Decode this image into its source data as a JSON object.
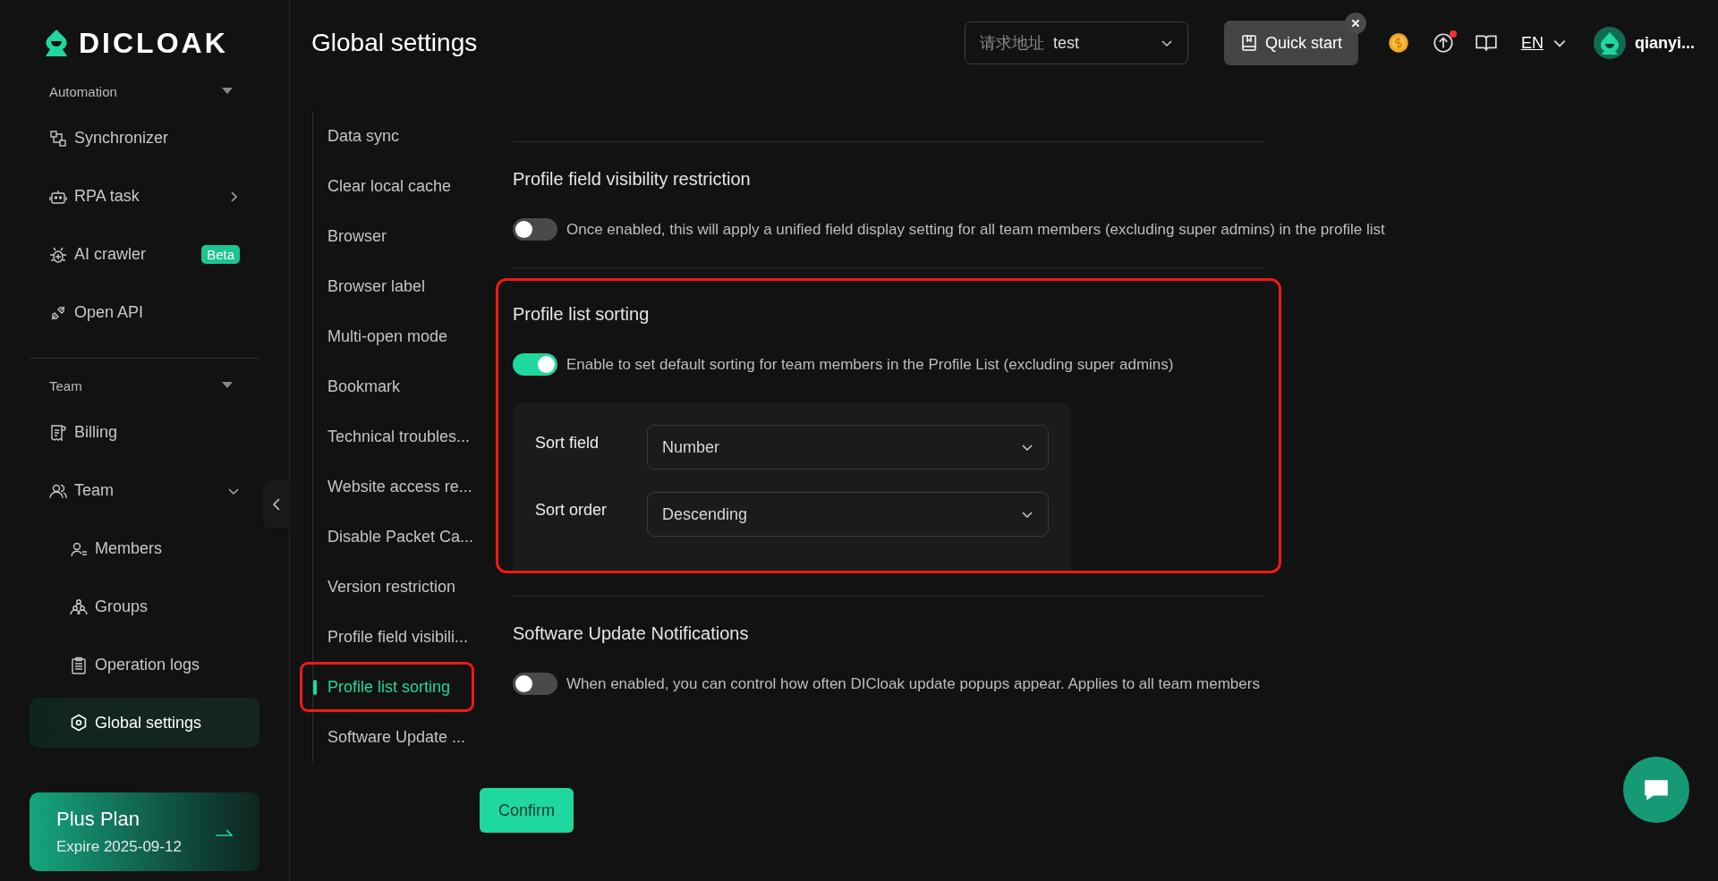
{
  "logo": {
    "text": "DICLOAK"
  },
  "sidebar": {
    "sections": [
      {
        "title": "Automation",
        "expanded": true,
        "items": [
          {
            "label": "Synchronizer",
            "kind": "link",
            "selected": false
          },
          {
            "label": "RPA task",
            "kind": "submenu",
            "selected": false
          },
          {
            "label": "AI crawler",
            "kind": "link",
            "badge": "Beta",
            "selected": false
          },
          {
            "label": "Open API",
            "kind": "link",
            "selected": false
          }
        ]
      },
      {
        "title": "Team",
        "expanded": true,
        "items": [
          {
            "label": "Billing",
            "kind": "link",
            "selected": false
          },
          {
            "label": "Team",
            "kind": "group",
            "expanded": true,
            "selected": false,
            "children": [
              {
                "label": "Members",
                "selected": false
              },
              {
                "label": "Groups",
                "selected": false
              },
              {
                "label": "Operation logs",
                "selected": false
              },
              {
                "label": "Global settings",
                "selected": true
              }
            ]
          }
        ]
      }
    ]
  },
  "plan": {
    "title": "Plus Plan",
    "expiry": "Expire 2025-09-12"
  },
  "header": {
    "title": "Global settings",
    "address": {
      "label": "请求地址",
      "value": "test"
    },
    "quick_start": "Quick start",
    "update_available": true,
    "language": "EN",
    "user": "qianyi..."
  },
  "settings_nav": [
    {
      "label": "Data sync",
      "selected": false,
      "highlighted": false
    },
    {
      "label": "Clear local cache",
      "selected": false,
      "highlighted": false
    },
    {
      "label": "Browser",
      "selected": false,
      "highlighted": false
    },
    {
      "label": "Browser label",
      "selected": false,
      "highlighted": false
    },
    {
      "label": "Multi-open mode",
      "selected": false,
      "highlighted": false
    },
    {
      "label": "Bookmark",
      "selected": false,
      "highlighted": false
    },
    {
      "label": "Technical troubles...",
      "selected": false,
      "highlighted": false
    },
    {
      "label": "Website access re...",
      "selected": false,
      "highlighted": false
    },
    {
      "label": "Disable Packet Ca...",
      "selected": false,
      "highlighted": false
    },
    {
      "label": "Version restriction",
      "selected": false,
      "highlighted": false
    },
    {
      "label": "Profile field visibili...",
      "selected": false,
      "highlighted": false
    },
    {
      "label": "Profile list sorting",
      "selected": true,
      "highlighted": true
    },
    {
      "label": "Software Update ...",
      "selected": false,
      "highlighted": false
    }
  ],
  "sections": [
    {
      "title": "Profile field visibility restriction",
      "on": false,
      "description": "Once enabled, this will apply a unified field display setting for all team members (excluding super admins) in the profile list",
      "highlighted": false
    },
    {
      "title": "Profile list sorting",
      "on": true,
      "description": "Enable to set default sorting for team members in the Profile List (excluding super admins)",
      "highlighted": true,
      "fields": [
        {
          "label": "Sort field",
          "value": "Number"
        },
        {
          "label": "Sort order",
          "value": "Descending"
        }
      ]
    },
    {
      "title": "Software Update Notifications",
      "on": false,
      "description": "When enabled, you can control how often DICloak update popups appear. Applies to all team members",
      "highlighted": false
    }
  ],
  "confirm": "Confirm"
}
